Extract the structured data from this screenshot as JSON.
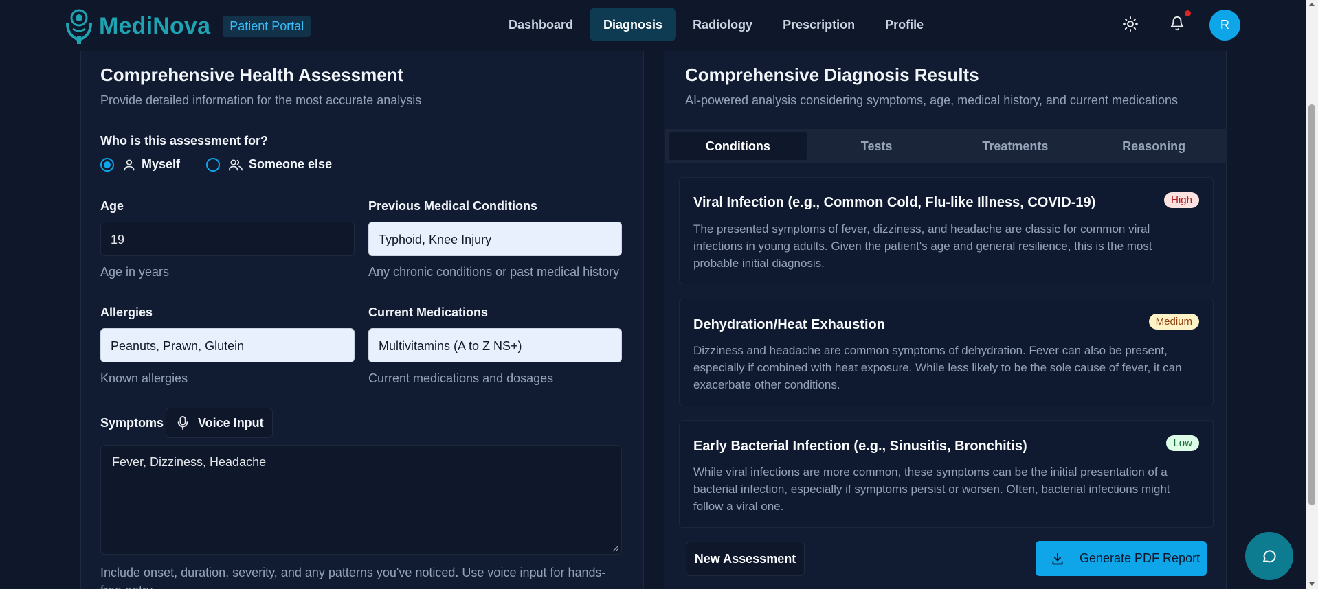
{
  "header": {
    "brand": "MediNova",
    "portal_badge": "Patient Portal",
    "nav": [
      "Dashboard",
      "Diagnosis",
      "Radiology",
      "Prescription",
      "Profile"
    ],
    "active_nav": "Diagnosis",
    "avatar_initial": "R"
  },
  "assessment": {
    "title": "Comprehensive Health Assessment",
    "subtitle": "Provide detailed information for the most accurate analysis",
    "who_label": "Who is this assessment for?",
    "who_options": [
      "Myself",
      "Someone else"
    ],
    "who_selected": "Myself",
    "age": {
      "label": "Age",
      "value": "19",
      "hint": "Age in years"
    },
    "conditions": {
      "label": "Previous Medical Conditions",
      "value": "Typhoid, Knee Injury",
      "hint": "Any chronic conditions or past medical history"
    },
    "allergies": {
      "label": "Allergies",
      "value": "Peanuts, Prawn, Glutein",
      "hint": "Known allergies"
    },
    "medications": {
      "label": "Current Medications",
      "value": "Multivitamins (A to Z NS+)",
      "hint": "Current medications and dosages"
    },
    "symptoms": {
      "label": "Symptoms",
      "voice_button": "Voice Input",
      "value": "Fever, Dizziness, Headache",
      "hint": "Include onset, duration, severity, and any patterns you've noticed. Use voice input for hands-free entry."
    }
  },
  "results": {
    "title": "Comprehensive Diagnosis Results",
    "subtitle": "AI-powered analysis considering symptoms, age, medical history, and current medications",
    "tabs": [
      "Conditions",
      "Tests",
      "Treatments",
      "Reasoning"
    ],
    "active_tab": "Conditions",
    "conditions": [
      {
        "title": "Viral Infection (e.g., Common Cold, Flu-like Illness, COVID-19)",
        "likelihood": "High",
        "description": "The presented symptoms of fever, dizziness, and headache are classic for common viral infections in young adults. Given the patient's age and general resilience, this is the most probable initial diagnosis."
      },
      {
        "title": "Dehydration/Heat Exhaustion",
        "likelihood": "Medium",
        "description": "Dizziness and headache are common symptoms of dehydration. Fever can also be present, especially if combined with heat exposure. While less likely to be the sole cause of fever, it can exacerbate other conditions."
      },
      {
        "title": "Early Bacterial Infection (e.g., Sinusitis, Bronchitis)",
        "likelihood": "Low",
        "description": "While viral infections are more common, these symptoms can be the initial presentation of a bacterial infection, especially if symptoms persist or worsen. Often, bacterial infections might follow a viral one."
      }
    ],
    "new_assessment_button": "New Assessment",
    "pdf_button": "Generate PDF Report"
  },
  "colors": {
    "background": "#0f172a",
    "panel": "#111c33",
    "accent": "#0ea5e9",
    "brand": "#1fa3b3",
    "high": "#b91c1c",
    "medium": "#92400e",
    "low": "#166534"
  },
  "icons": [
    "medinova-logo-icon",
    "sun-icon",
    "bell-icon",
    "user-icon",
    "users-icon",
    "microphone-icon",
    "download-icon",
    "chat-icon"
  ]
}
